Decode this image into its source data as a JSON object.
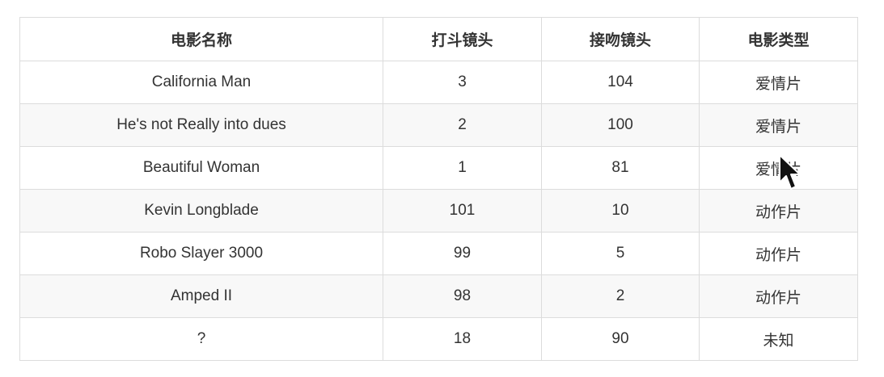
{
  "table": {
    "headers": [
      "电影名称",
      "打斗镜头",
      "接吻镜头",
      "电影类型"
    ],
    "rows": [
      [
        "California Man",
        "3",
        "104",
        "爱情片"
      ],
      [
        "He's not Really into dues",
        "2",
        "100",
        "爱情片"
      ],
      [
        "Beautiful Woman",
        "1",
        "81",
        "爱情片"
      ],
      [
        "Kevin Longblade",
        "101",
        "10",
        "动作片"
      ],
      [
        "Robo Slayer 3000",
        "99",
        "5",
        "动作片"
      ],
      [
        "Amped II",
        "98",
        "2",
        "动作片"
      ],
      [
        "?",
        "18",
        "90",
        "未知"
      ]
    ]
  },
  "cursor": {
    "icon": "mouse-pointer-icon"
  }
}
